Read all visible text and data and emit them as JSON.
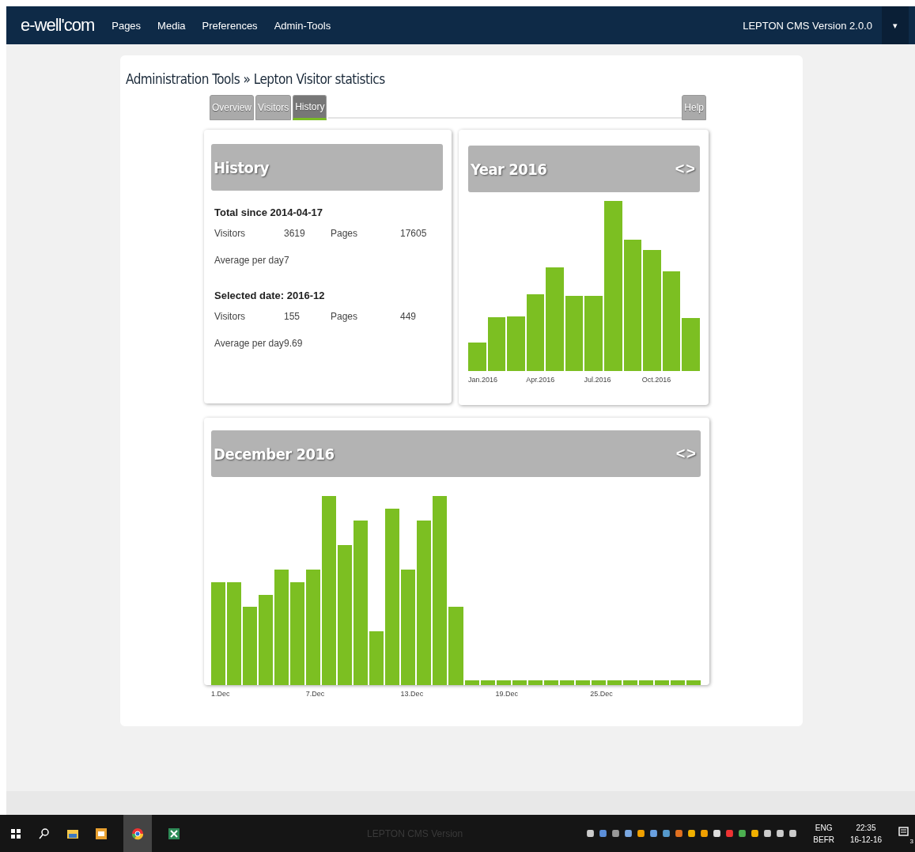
{
  "navbar": {
    "logo": "e-well'com",
    "menu": [
      "Pages",
      "Media",
      "Preferences",
      "Admin-Tools"
    ],
    "version": "LEPTON CMS Version 2.0.0",
    "dropdown": "▾"
  },
  "breadcrumb": "Administration Tools » Lepton Visitor statistics",
  "tabs": [
    {
      "label": "Overview",
      "selected": false
    },
    {
      "label": "Visitors",
      "selected": false
    },
    {
      "label": "History",
      "selected": true
    }
  ],
  "help_button": "Help",
  "history": {
    "title": "History",
    "sections": [
      {
        "heading": "Total since 2014-04-17",
        "visitors_label": "Visitors",
        "visitors": "3619",
        "pages_label": "Pages",
        "pages": "17605",
        "average_label": "Average per day",
        "average": "7"
      },
      {
        "heading": "Selected date: 2016-12",
        "visitors_label": "Visitors",
        "visitors": "155",
        "pages_label": "Pages",
        "pages": "449",
        "average_label": "Average per day",
        "average": "9.69"
      }
    ]
  },
  "year_panel": {
    "title": "Year 2016",
    "prev": "<",
    "next": ">",
    "x_labels": [
      "Jan.2016",
      "Apr.2016",
      "Jul.2016",
      "Oct.2016"
    ]
  },
  "month_panel": {
    "title": "December 2016",
    "prev": "<",
    "next": ">",
    "x_labels": [
      "1.Dec",
      "7.Dec",
      "13.Dec",
      "19.Dec",
      "25.Dec"
    ]
  },
  "taskbar": {
    "center_text": "LEPTON CMS Version",
    "language": "ENG",
    "layout": "BEFR",
    "time": "22:35",
    "date": "16-12-16",
    "notifications": "3"
  }
}
